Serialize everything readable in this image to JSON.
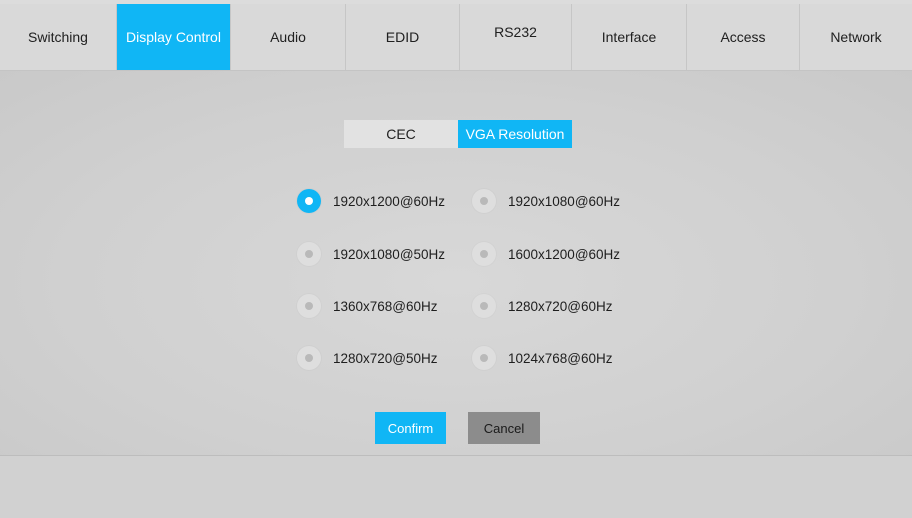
{
  "nav": {
    "tabs": [
      {
        "label": "Switching",
        "active": false
      },
      {
        "label": "Display Control",
        "active": true
      },
      {
        "label": "Audio",
        "active": false
      },
      {
        "label": "EDID",
        "active": false
      },
      {
        "label": "RS232",
        "active": false
      },
      {
        "label": "Interface",
        "active": false
      },
      {
        "label": "Access",
        "active": false
      },
      {
        "label": "Network",
        "active": false
      }
    ]
  },
  "subtabs": {
    "cec": "CEC",
    "vga_resolution": "VGA Resolution",
    "active": "VGA Resolution"
  },
  "resolutions": {
    "selected": "1920x1200@60Hz",
    "options": [
      "1920x1200@60Hz",
      "1920x1080@60Hz",
      "1920x1080@50Hz",
      "1600x1200@60Hz",
      "1360x768@60Hz",
      "1280x720@60Hz",
      "1280x720@50Hz",
      "1024x768@60Hz"
    ]
  },
  "actions": {
    "confirm": "Confirm",
    "cancel": "Cancel"
  },
  "colors": {
    "accent": "#10b6f5",
    "cancel": "#8c8c8c",
    "background": "#d3d3d3"
  }
}
